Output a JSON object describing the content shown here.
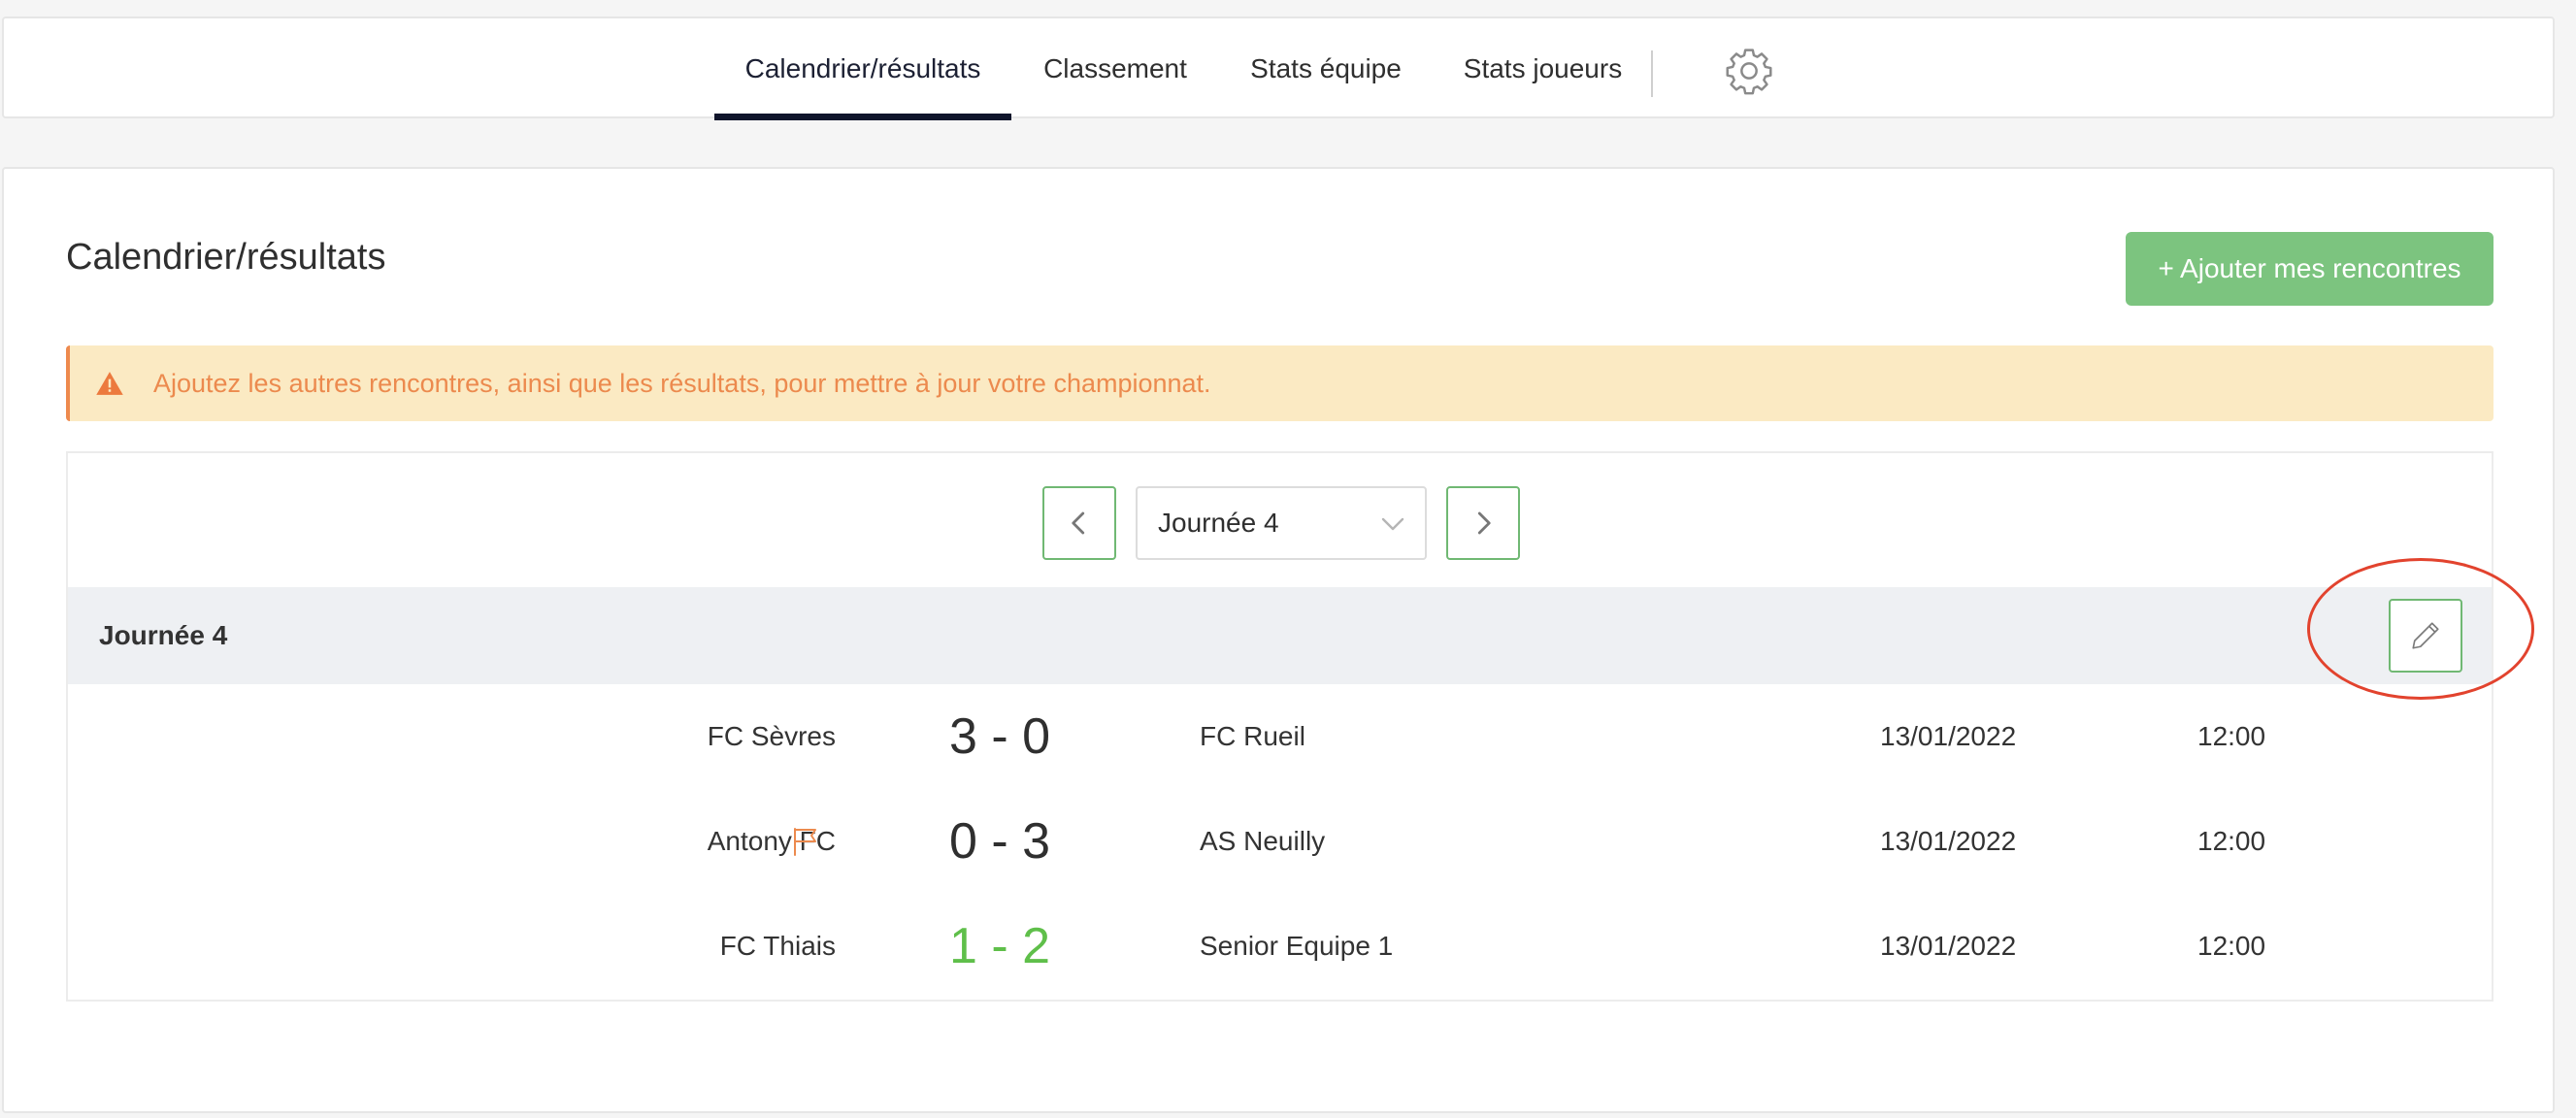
{
  "nav": {
    "tabs": [
      {
        "label": "Calendrier/résultats",
        "active": true
      },
      {
        "label": "Classement",
        "active": false
      },
      {
        "label": "Stats équipe",
        "active": false
      },
      {
        "label": "Stats joueurs",
        "active": false
      }
    ],
    "settings_icon": "gear-icon"
  },
  "main": {
    "title": "Calendrier/résultats",
    "add_button": "+ Ajouter mes rencontres",
    "alert": {
      "icon": "warning-icon",
      "text": "Ajoutez les autres rencontres, ainsi que les résultats, pour mettre à jour votre championnat."
    },
    "round_select": {
      "value": "Journée 4",
      "prev_icon": "chevron-left-icon",
      "next_icon": "chevron-right-icon"
    },
    "day": {
      "title": "Journée 4",
      "edit_icon": "pencil-icon",
      "matches": [
        {
          "home": "FC Sèvres",
          "score": "3 - 0",
          "away": "FC Rueil",
          "date": "13/01/2022",
          "time": "12:00",
          "flag": false,
          "highlight": false
        },
        {
          "home": "Antony FC",
          "score": "0 - 3",
          "away": "AS Neuilly",
          "date": "13/01/2022",
          "time": "12:00",
          "flag": true,
          "highlight": false
        },
        {
          "home": "FC Thiais",
          "score": "1 - 2",
          "away": "Senior Equipe 1",
          "date": "13/01/2022",
          "time": "12:00",
          "flag": false,
          "highlight": true
        }
      ]
    }
  },
  "colors": {
    "accent_green": "#7cc47f",
    "nav_underline": "#10152b",
    "alert_bg": "#fbeac3",
    "alert_text": "#ec8a4e",
    "win_score": "#5fbf4a",
    "annotation_ring": "#e2432e"
  }
}
